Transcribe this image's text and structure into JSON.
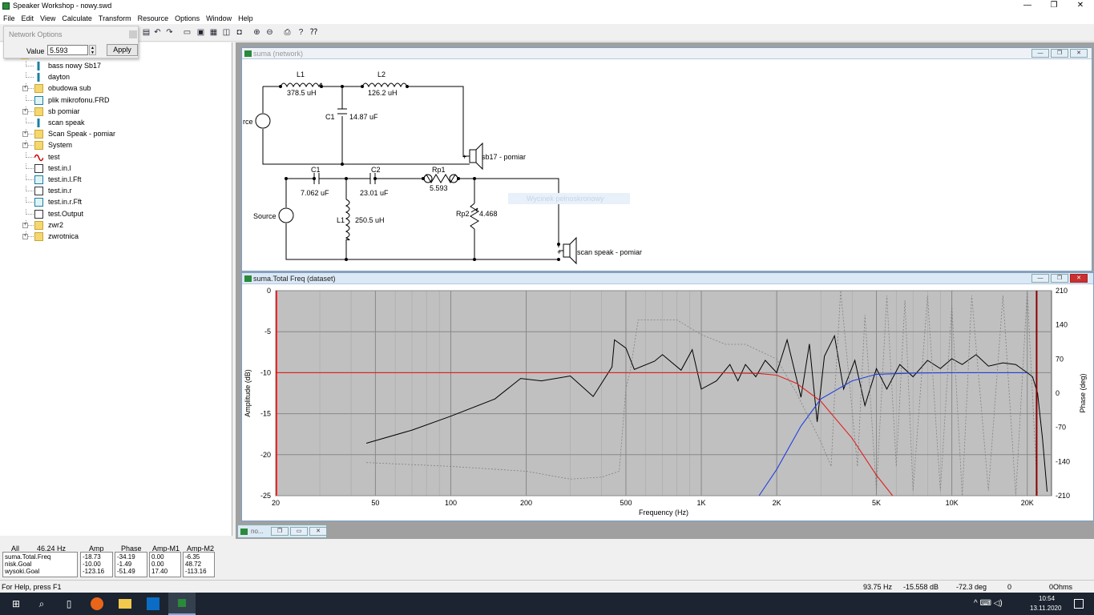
{
  "app": {
    "title": "Speaker Workshop - nowy.swd"
  },
  "window_controls": {
    "minimize": "—",
    "maximize": "❐",
    "close": "✕"
  },
  "menu": [
    "File",
    "Edit",
    "View",
    "Calculate",
    "Transform",
    "Resource",
    "Options",
    "Window",
    "Help"
  ],
  "network_options": {
    "title": "Network Options",
    "value_label": "Value",
    "value": "5.593",
    "apply_label": "Apply"
  },
  "tree": {
    "items": [
      {
        "label": "bass nowy Sb17",
        "icon": "speaker-icon",
        "expandable": false
      },
      {
        "label": "dayton",
        "icon": "speaker-icon",
        "expandable": false
      },
      {
        "label": "obudowa sub",
        "icon": "folder-icon",
        "expandable": true
      },
      {
        "label": "plik mikrofonu.FRD",
        "icon": "frd-file-icon",
        "expandable": false
      },
      {
        "label": "sb pomiar",
        "icon": "folder-icon",
        "expandable": true
      },
      {
        "label": "scan speak",
        "icon": "speaker-icon",
        "expandable": false
      },
      {
        "label": "Scan Speak - pomiar",
        "icon": "folder-icon",
        "expandable": true
      },
      {
        "label": "System",
        "icon": "folder-icon",
        "expandable": true
      },
      {
        "label": "test",
        "icon": "signal-icon",
        "expandable": false
      },
      {
        "label": "test.in.l",
        "icon": "document-icon",
        "expandable": false
      },
      {
        "label": "test.in.l.Fft",
        "icon": "fft-document-icon",
        "expandable": false
      },
      {
        "label": "test.in.r",
        "icon": "document-icon",
        "expandable": false
      },
      {
        "label": "test.in.r.Fft",
        "icon": "fft-document-icon",
        "expandable": false
      },
      {
        "label": "test.Output",
        "icon": "document-icon",
        "expandable": false
      },
      {
        "label": "zwr2",
        "icon": "folder-icon",
        "expandable": true
      },
      {
        "label": "zwrotnica",
        "icon": "folder-icon",
        "expandable": true
      }
    ]
  },
  "network_window": {
    "title": "suma (network)",
    "labels": {
      "L1_top": "L1",
      "L1_top_val": "378.5 uH",
      "L2_top": "L2",
      "L2_top_val": "126.2 uH",
      "C1_top": "C1",
      "C1_top_val": "14.87 uF",
      "source_top": "rce",
      "drv1": "sb17 - pomiar",
      "C1_bot": "C1",
      "C1_bot_val": "7.062 uF",
      "C2_bot": "C2",
      "C2_bot_val": "23.01 uF",
      "Rp1": "Rp1",
      "Rp1_val": "5.593",
      "L1_bot": "L1",
      "L1_bot_val": "250.5 uH",
      "Rp2": "Rp2",
      "Rp2_val": "4.468",
      "source_bot": "Source",
      "drv2": "scan speak - pomiar",
      "ghost": "Wycinek pełnoskronowy",
      "plus1": "+",
      "plus2": "+"
    }
  },
  "freq_window": {
    "title": "suma.Total Freq (dataset)"
  },
  "minimized_window": {
    "title": "no..."
  },
  "chart_data": {
    "type": "line",
    "title": "",
    "xlabel": "Frequency (Hz)",
    "ylabel": "Amplitude (dB)",
    "y2label": "Phase (deg)",
    "xscale": "log",
    "xlim": [
      20,
      25000
    ],
    "ylim": [
      -25,
      0
    ],
    "y2lim": [
      -210,
      210
    ],
    "x_ticks": [
      20,
      50,
      100,
      200,
      500,
      1000,
      2000,
      5000,
      10000,
      20000
    ],
    "x_tick_labels": [
      "20",
      "50",
      "100",
      "200",
      "500",
      "1K",
      "2K",
      "5K",
      "10K",
      "20K"
    ],
    "y_ticks": [
      0,
      -5,
      -10,
      -15,
      -20,
      -25
    ],
    "y_tick_labels": [
      "0",
      "-5",
      "-10",
      "-15",
      "-20",
      "-25"
    ],
    "y2_ticks": [
      210,
      140,
      70,
      0,
      -70,
      -140,
      -210
    ],
    "y2_tick_labels": [
      "210",
      "140",
      "70",
      "0",
      "-70",
      "-140",
      "-210"
    ],
    "markers_hz": [
      20,
      21800
    ],
    "grid": true,
    "colors": {
      "plot_bg": "#c0c0c0",
      "grid": "#888888",
      "red": "#e02020",
      "blue": "#2040e0",
      "amp": "#000000",
      "phase": "#808080",
      "marker_left": "#ff0000",
      "marker_right": "#8b0000"
    },
    "series": [
      {
        "values": [
          [
            46,
            -18.6
          ],
          [
            70,
            -17
          ],
          [
            100,
            -15.3
          ],
          [
            150,
            -13.2
          ],
          [
            190,
            -10.7
          ],
          [
            230,
            -11
          ],
          [
            300,
            -10.4
          ],
          [
            370,
            -12.9
          ],
          [
            440,
            -9.3
          ],
          [
            450,
            -6
          ],
          [
            500,
            -7
          ],
          [
            540,
            -9.6
          ],
          [
            650,
            -8.6
          ],
          [
            700,
            -7.8
          ],
          [
            830,
            -9.7
          ],
          [
            920,
            -7.2
          ],
          [
            1000,
            -12
          ],
          [
            1150,
            -11
          ],
          [
            1300,
            -9
          ],
          [
            1400,
            -11
          ],
          [
            1500,
            -9
          ],
          [
            1650,
            -10.5
          ],
          [
            1800,
            -8.5
          ],
          [
            2000,
            -10
          ],
          [
            2200,
            -6
          ],
          [
            2500,
            -13
          ],
          [
            2700,
            -6.5
          ],
          [
            2900,
            -16
          ],
          [
            3100,
            -8
          ],
          [
            3400,
            -5.5
          ],
          [
            3700,
            -12
          ],
          [
            4100,
            -8.5
          ],
          [
            4500,
            -14
          ],
          [
            5000,
            -9.5
          ],
          [
            5500,
            -12
          ],
          [
            6200,
            -9
          ],
          [
            7000,
            -10.5
          ],
          [
            8000,
            -8.5
          ],
          [
            9000,
            -9.5
          ],
          [
            10000,
            -8.3
          ],
          [
            11000,
            -9
          ],
          [
            12500,
            -7.8
          ],
          [
            14000,
            -9.2
          ],
          [
            16000,
            -8.8
          ],
          [
            18000,
            -9
          ],
          [
            20000,
            -10
          ],
          [
            21000,
            -10.5
          ],
          [
            22000,
            -12.5
          ],
          [
            23000,
            -18
          ],
          [
            24000,
            -24.5
          ]
        ]
      },
      {
        "values": [
          [
            20,
            -10
          ],
          [
            1200,
            -10
          ],
          [
            1700,
            -10.1
          ],
          [
            2000,
            -10.3
          ],
          [
            2400,
            -11.3
          ],
          [
            3000,
            -13.5
          ],
          [
            4000,
            -18
          ],
          [
            5000,
            -22.5
          ],
          [
            5800,
            -25
          ]
        ]
      },
      {
        "values": [
          [
            1700,
            -25
          ],
          [
            2000,
            -21.8
          ],
          [
            2500,
            -16.5
          ],
          [
            3000,
            -13.2
          ],
          [
            4000,
            -11
          ],
          [
            5000,
            -10.2
          ],
          [
            7000,
            -10.05
          ],
          [
            10000,
            -10
          ],
          [
            20000,
            -10
          ]
        ]
      },
      {
        "values": [
          [
            46,
            -142
          ],
          [
            100,
            -150
          ],
          [
            200,
            -160
          ],
          [
            300,
            -176
          ],
          [
            400,
            -172
          ],
          [
            470,
            -160
          ],
          [
            500,
            10
          ],
          [
            520,
            45
          ],
          [
            560,
            150
          ],
          [
            800,
            150
          ],
          [
            1000,
            120
          ],
          [
            1250,
            100
          ],
          [
            1500,
            100
          ],
          [
            2000,
            70
          ],
          [
            2400,
            0
          ],
          [
            3000,
            -100
          ],
          [
            3300,
            -150
          ],
          [
            3400,
            -10
          ],
          [
            3600,
            210
          ],
          [
            4200,
            -150
          ],
          [
            4500,
            160
          ],
          [
            5000,
            -200
          ],
          [
            5500,
            200
          ],
          [
            6000,
            -150
          ],
          [
            6500,
            190
          ],
          [
            7000,
            -200
          ],
          [
            8000,
            200
          ],
          [
            9000,
            -200
          ],
          [
            10000,
            180
          ],
          [
            11000,
            -210
          ],
          [
            12000,
            200
          ],
          [
            14000,
            -200
          ],
          [
            16000,
            200
          ],
          [
            18000,
            -210
          ],
          [
            20000,
            210
          ],
          [
            22000,
            -210
          ]
        ]
      }
    ]
  },
  "readout": {
    "col_all": "All",
    "col_freq": "46.24 Hz",
    "col_amp": "Amp",
    "col_phase": "Phase",
    "col_m1": "Amp-M1",
    "col_m2": "Amp-M2",
    "names": [
      "suma.Total.Freq",
      "nisk.Goal",
      "wysoki.Goal"
    ],
    "amp": [
      "-18.73",
      "-10.00",
      "-123.16"
    ],
    "phase": [
      "-34.19",
      "-1.49",
      "-51.49"
    ],
    "m1": [
      "0.00",
      "0.00",
      "17.40"
    ],
    "m2": [
      "-6.35",
      "48.72",
      "-113.16"
    ]
  },
  "status": {
    "help": "For Help, press F1",
    "freq": "93.75 Hz",
    "db": "-15.558 dB",
    "deg": "-72.3 deg",
    "n": "0",
    "ohms": "0Ohms"
  },
  "taskbar": {
    "time": "10:54",
    "date": "13.11.2020",
    "tray": "^ ⌨ ◁)"
  }
}
